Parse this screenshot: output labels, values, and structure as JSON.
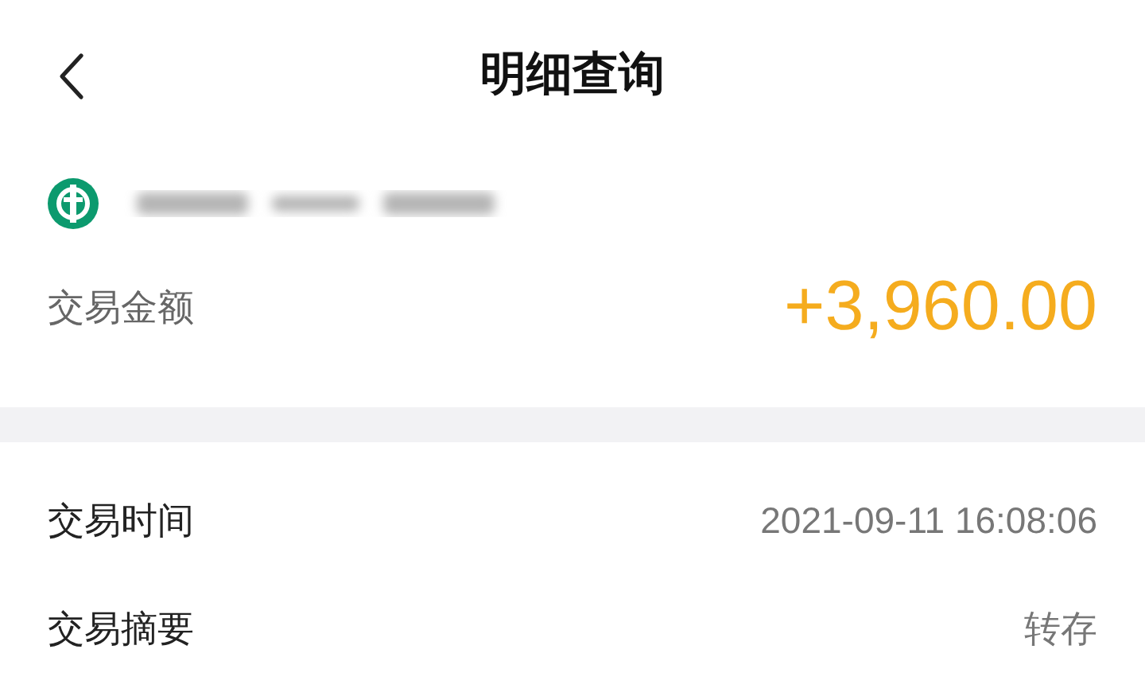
{
  "header": {
    "title": "明细查询"
  },
  "account": {
    "amount_label": "交易金额",
    "amount": "+3,960.00"
  },
  "details": [
    {
      "label": "交易时间",
      "value": "2021-09-11 16:08:06"
    },
    {
      "label": "交易摘要",
      "value": "转存"
    }
  ]
}
